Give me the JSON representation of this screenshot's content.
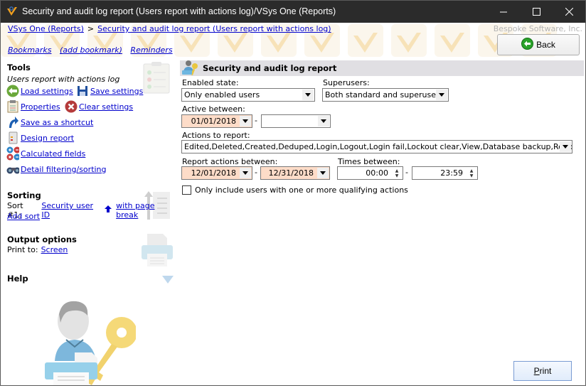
{
  "window": {
    "title": "Security and audit log report (Users report with actions log)/VSys One (Reports)",
    "controls": {
      "minimize": "—",
      "maximize": "☐",
      "close": "✕"
    }
  },
  "breadcrumb": {
    "items": [
      "VSys One (Reports)",
      "Security and audit log report (Users report with actions log)"
    ],
    "separator": ">"
  },
  "company": "Bespoke Software, Inc.",
  "bookmarks": {
    "bookmarks": "Bookmarks",
    "add_bookmark": "(add bookmark)",
    "reminders": "Reminders"
  },
  "back_button": {
    "label": "Back"
  },
  "sidebar": {
    "tools": {
      "title": "Tools",
      "subtitle": "Users report with actions log",
      "load_settings": "Load settings",
      "save_settings": "Save settings",
      "properties": "Properties",
      "clear_settings": "Clear settings",
      "save_shortcut": "Save as a shortcut",
      "design_report": "Design report",
      "calculated_fields": "Calculated fields",
      "detail_filtering": "Detail filtering/sorting"
    },
    "sorting": {
      "title": "Sorting",
      "sort_prefix": "Sort #1:",
      "sort_field": "Security user ID",
      "page_break": "with page break",
      "add_sort": "Add sort"
    },
    "output": {
      "title": "Output options",
      "print_to_label": "Print to:",
      "print_to_value": "Screen"
    },
    "help": {
      "title": "Help"
    }
  },
  "main": {
    "section_title": "Security and audit log report",
    "enabled_state": {
      "label": "Enabled state:",
      "value": "Only enabled users"
    },
    "superusers": {
      "label": "Superusers:",
      "value": "Both standard and superusers"
    },
    "active_between": {
      "label": "Active between:",
      "from": "01/01/2018",
      "to": "",
      "sep": "-"
    },
    "actions": {
      "label": "Actions to report:",
      "value": "Edited,Deleted,Created,Deduped,Login,Logout,Login fail,Lockout clear,View,Database backup,Report printed"
    },
    "report_between": {
      "label": "Report actions between:",
      "from": "12/01/2018",
      "to": "12/31/2018",
      "sep": "-"
    },
    "times_between": {
      "label": "Times between:",
      "from": "00:00",
      "to": "23:59",
      "sep": "-"
    },
    "only_qualifying": {
      "label": "Only include users with one or more qualifying actions",
      "checked": false
    }
  },
  "print_button": {
    "label": "Print"
  },
  "colors": {
    "link": "#0000cc",
    "required_field": "#fddcc8",
    "header_bar": "#e0dfe3",
    "titlebar": "#2b2b2b"
  }
}
